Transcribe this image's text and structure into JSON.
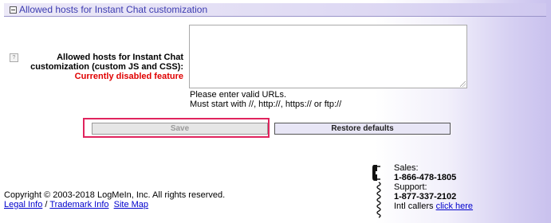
{
  "section": {
    "title": "Allowed hosts for Instant Chat customization"
  },
  "help_icon_glyph": "?",
  "field": {
    "label_line1": "Allowed hosts for Instant Chat",
    "label_line2": "customization (custom JS and CSS):",
    "disabled_note": "Currently disabled feature",
    "value": "",
    "hint_line1": "Please enter valid URLs.",
    "hint_line2": "Must start with //, http://, https:// or ftp://"
  },
  "buttons": {
    "save": "Save",
    "restore": "Restore defaults"
  },
  "contact": {
    "sales_label": "Sales:",
    "sales_phone": "1-866-478-1805",
    "support_label": "Support:",
    "support_phone": "1-877-337-2102",
    "intl_prefix": "Intl callers",
    "intl_link": "click here"
  },
  "footer": {
    "copyright": "Copyright © 2003-2018 LogMeIn, Inc. All rights reserved.",
    "legal_link": "Legal Info",
    "separator": "/",
    "trademark_link": "Trademark Info",
    "sitemap_link": "Site Map"
  },
  "colors": {
    "header_text": "#3b3bb0",
    "disabled_text": "#e00000",
    "highlight_border": "#e0245e",
    "link": "#0000cc"
  },
  "icons": [
    "collapse-icon",
    "help-icon",
    "phone-icon"
  ]
}
